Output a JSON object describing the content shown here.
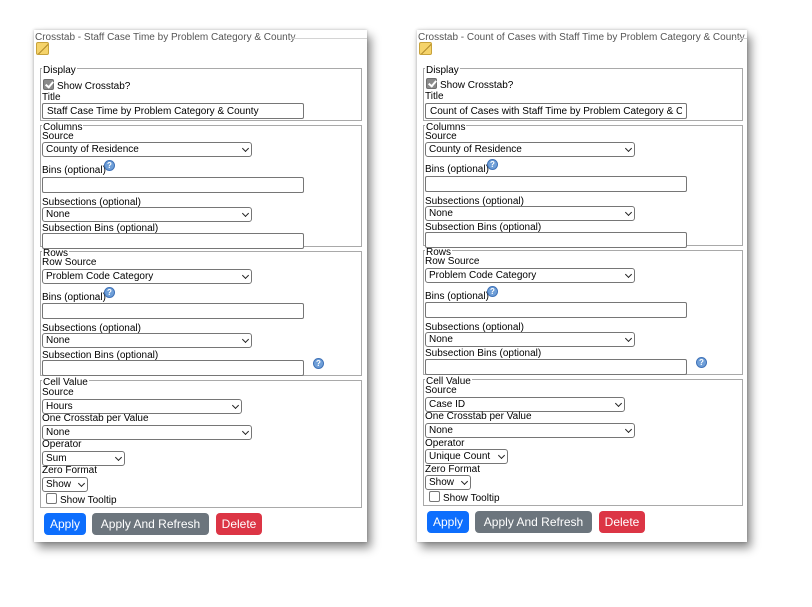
{
  "left": {
    "title": "Crosstab - Staff Case Time by Problem Category & County",
    "display": {
      "legend": "Display",
      "show_crosstab_label": "Show Crosstab?",
      "show_crosstab_checked": true,
      "title_label": "Title",
      "title_value": "Staff Case Time by Problem Category & County"
    },
    "columns": {
      "legend": "Columns",
      "source_label": "Source",
      "source_value": "County of Residence",
      "bins_label": "Bins (optional)",
      "bins_value": "",
      "subsections_label": "Subsections (optional)",
      "subsections_value": "None",
      "subsection_bins_label": "Subsection Bins (optional)",
      "subsection_bins_value": ""
    },
    "rows": {
      "legend": "Rows",
      "source_label": "Row Source",
      "source_value": "Problem Code Category",
      "bins_label": "Bins (optional)",
      "bins_value": "",
      "subsections_label": "Subsections (optional)",
      "subsections_value": "None",
      "subsection_bins_label": "Subsection Bins (optional)",
      "subsection_bins_value": ""
    },
    "cell_value": {
      "legend": "Cell Value",
      "source_label": "Source",
      "source_value": "Hours",
      "per_value_label": "One Crosstab per Value",
      "per_value_value": "None",
      "operator_label": "Operator",
      "operator_value": "Sum",
      "zero_format_label": "Zero Format",
      "zero_format_value": "Show",
      "tooltip_label": "Show Tooltip",
      "tooltip_checked": false
    },
    "buttons": {
      "apply": "Apply",
      "apply_refresh": "Apply And Refresh",
      "delete": "Delete"
    }
  },
  "right": {
    "title": "Crosstab - Count of Cases with Staff Time by Problem Category & County",
    "display": {
      "legend": "Display",
      "show_crosstab_label": "Show Crosstab?",
      "show_crosstab_checked": true,
      "title_label": "Title",
      "title_value": "Count of Cases with Staff Time by Problem Category & C"
    },
    "columns": {
      "legend": "Columns",
      "source_label": "Source",
      "source_value": "County of Residence",
      "bins_label": "Bins (optional)",
      "bins_value": "",
      "subsections_label": "Subsections (optional)",
      "subsections_value": "None",
      "subsection_bins_label": "Subsection Bins (optional)",
      "subsection_bins_value": ""
    },
    "rows": {
      "legend": "Rows",
      "source_label": "Row Source",
      "source_value": "Problem Code Category",
      "bins_label": "Bins (optional)",
      "bins_value": "",
      "subsections_label": "Subsections (optional)",
      "subsections_value": "None",
      "subsection_bins_label": "Subsection Bins (optional)",
      "subsection_bins_value": ""
    },
    "cell_value": {
      "legend": "Cell Value",
      "source_label": "Source",
      "source_value": "Case ID",
      "per_value_label": "One Crosstab per Value",
      "per_value_value": "None",
      "operator_label": "Operator",
      "operator_value": "Unique Count",
      "zero_format_label": "Zero Format",
      "zero_format_value": "Show",
      "tooltip_label": "Show Tooltip",
      "tooltip_checked": false
    },
    "buttons": {
      "apply": "Apply",
      "apply_refresh": "Apply And Refresh",
      "delete": "Delete"
    }
  },
  "icons": {
    "note": "note-icon",
    "help": "help-icon",
    "chevron": "chevron-down-icon",
    "check": "checkbox-checked-icon"
  },
  "colors": {
    "apply": "#0d6efd",
    "apply_refresh": "#6c757d",
    "delete": "#dc3545",
    "help": "#6f9fd8"
  }
}
